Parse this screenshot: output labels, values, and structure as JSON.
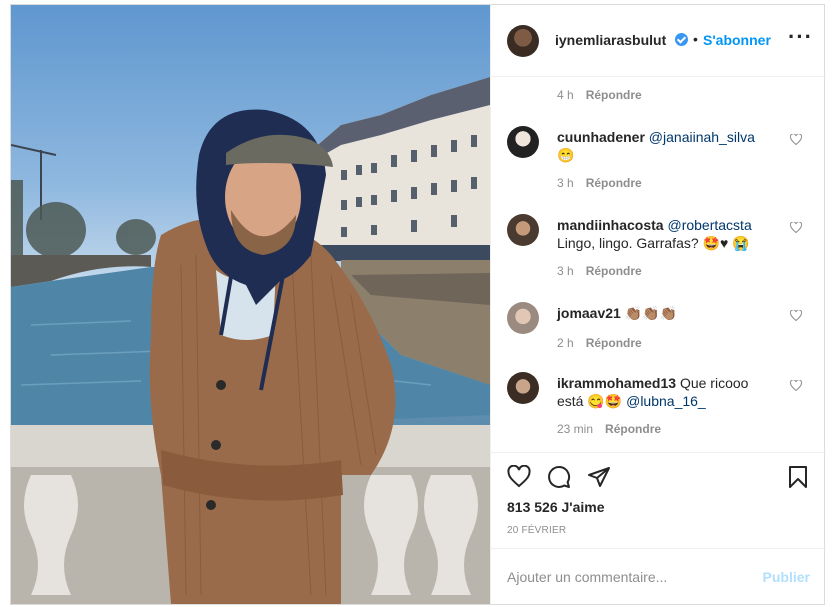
{
  "post": {
    "username": "iynemliarasbulut",
    "follow_label": "S'abonner",
    "dot": "•",
    "more_icon": "more-options-icon"
  },
  "comments": {
    "first_meta": {
      "time": "4 h",
      "reply": "Répondre"
    },
    "items": [
      {
        "user": "cuunhadener",
        "text": "@janaiinah_silva",
        "emoji": "😁",
        "time": "3 h",
        "reply": "Répondre"
      },
      {
        "user": "mandiinhacosta",
        "text": "@robertacsta",
        "line2": "Lingo, lingo. Garrafas? 🤩♥ 😭",
        "time": "3 h",
        "reply": "Répondre"
      },
      {
        "user": "jomaav21",
        "text": "👏🏽👏🏽👏🏽",
        "time": "2 h",
        "reply": "Répondre"
      },
      {
        "user": "ikrammohamed13",
        "text": "Que ricooo",
        "line2_a": "está 😋🤩",
        "line2_b": "@lubna_16_",
        "time": "23 min",
        "reply": "Répondre"
      }
    ]
  },
  "actions": {
    "likes": "813 526 J'aime",
    "date": "20 FÉVRIER"
  },
  "add_comment": {
    "placeholder": "Ajouter un commentaire...",
    "post_label": "Publier"
  },
  "colors": {
    "accent": "#0095f6",
    "verified": "#3897f0",
    "muted": "#8e8e8e"
  }
}
